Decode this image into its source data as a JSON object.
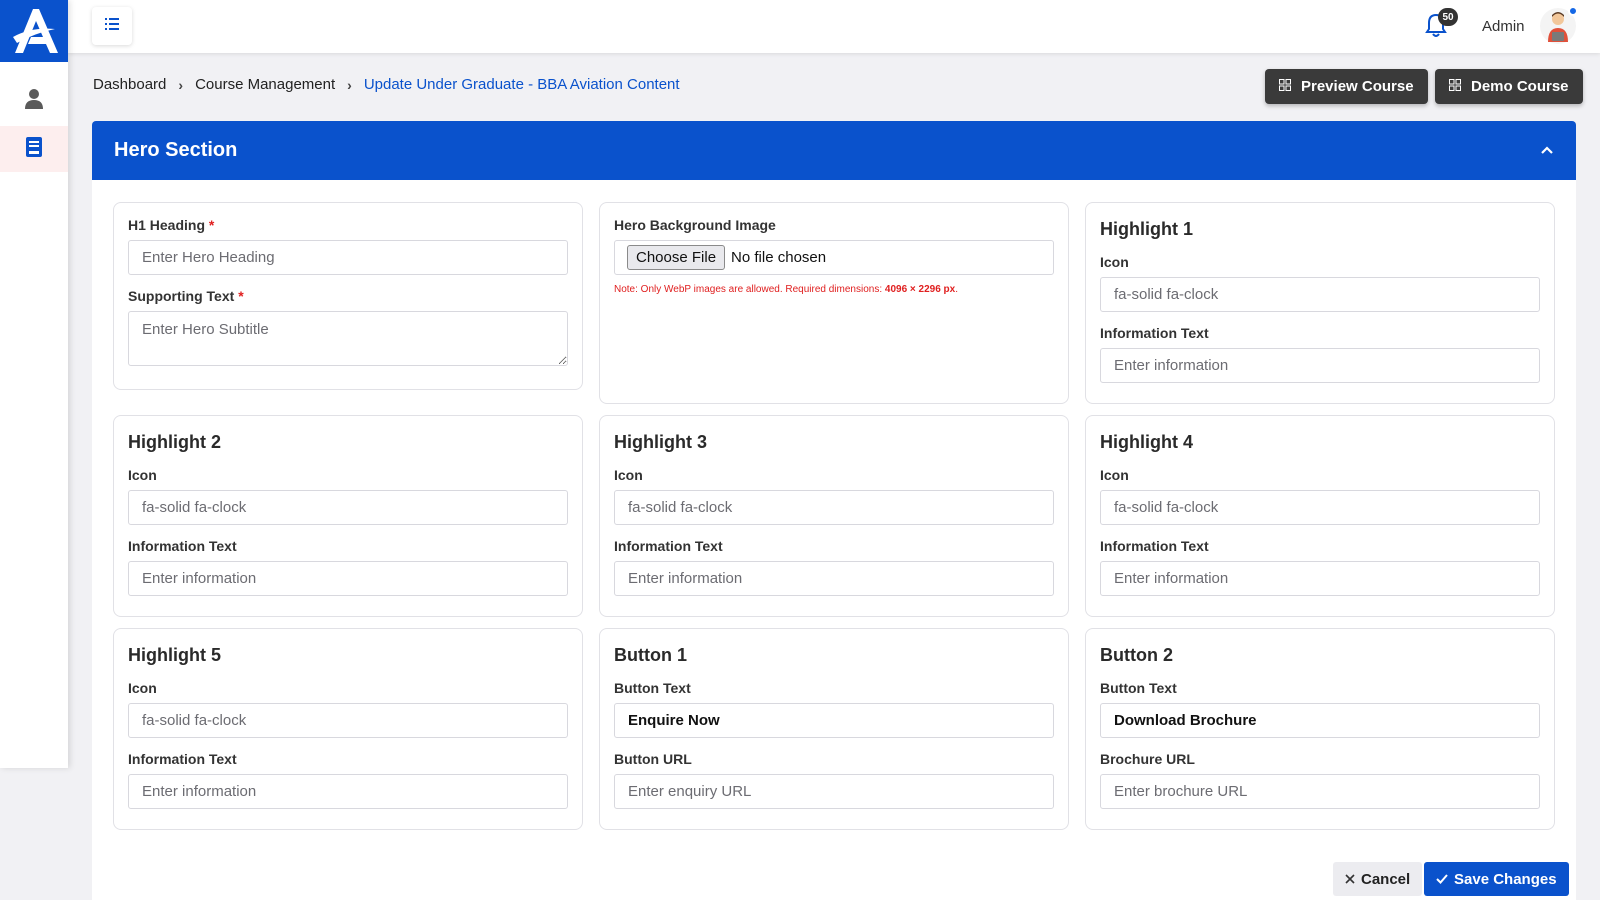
{
  "colors": {
    "primary": "#0a52cc",
    "dark_button": "#3a3a3a",
    "required": "#e02020"
  },
  "sidebar": {
    "logo_icon": "logo-a-icon",
    "items": [
      {
        "icon": "user-icon"
      },
      {
        "icon": "book-icon"
      }
    ]
  },
  "topbar": {
    "menu_icon": "list-icon",
    "notifications_count": "50",
    "user_name": "Admin"
  },
  "breadcrumb": {
    "items": [
      "Dashboard",
      "Course Management",
      "Update Under Graduate - BBA Aviation Content"
    ]
  },
  "actions": {
    "preview_label": "Preview Course",
    "demo_label": "Demo Course"
  },
  "panel": {
    "title": "Hero Section"
  },
  "hero_text": {
    "h1_label": "H1 Heading",
    "h1_placeholder": "Enter Hero Heading",
    "supporting_label": "Supporting Text",
    "supporting_placeholder": "Enter Hero Subtitle",
    "required_mark": "*"
  },
  "hero_image": {
    "label": "Hero Background Image",
    "choose_file": "Choose File",
    "file_status": "No file chosen",
    "note_prefix": "Note: Only WebP images are allowed. Required dimensions: ",
    "note_dims": "4096 × 2296 px",
    "note_suffix": "."
  },
  "highlights": [
    {
      "title": "Highlight 1",
      "icon_label": "Icon",
      "icon_placeholder": "fa-solid fa-clock",
      "info_label": "Information Text",
      "info_placeholder": "Enter information"
    },
    {
      "title": "Highlight 2",
      "icon_label": "Icon",
      "icon_placeholder": "fa-solid fa-clock",
      "info_label": "Information Text",
      "info_placeholder": "Enter information"
    },
    {
      "title": "Highlight 3",
      "icon_label": "Icon",
      "icon_placeholder": "fa-solid fa-clock",
      "info_label": "Information Text",
      "info_placeholder": "Enter information"
    },
    {
      "title": "Highlight 4",
      "icon_label": "Icon",
      "icon_placeholder": "fa-solid fa-clock",
      "info_label": "Information Text",
      "info_placeholder": "Enter information"
    },
    {
      "title": "Highlight 5",
      "icon_label": "Icon",
      "icon_placeholder": "fa-solid fa-clock",
      "info_label": "Information Text",
      "info_placeholder": "Enter information"
    }
  ],
  "buttons": [
    {
      "title": "Button 1",
      "text_label": "Button Text",
      "text_value": "Enquire Now",
      "url_label": "Button URL",
      "url_placeholder": "Enter enquiry URL"
    },
    {
      "title": "Button 2",
      "text_label": "Button Text",
      "text_value": "Download Brochure",
      "url_label": "Brochure URL",
      "url_placeholder": "Enter brochure URL"
    }
  ],
  "footer": {
    "cancel_label": "Cancel",
    "save_label": "Save Changes"
  }
}
